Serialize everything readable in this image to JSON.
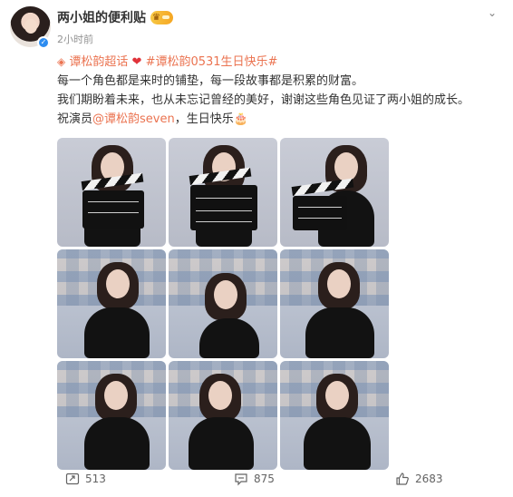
{
  "post": {
    "author": "两小姐的便利贴",
    "time": "2小时前",
    "topics": "谭松韵超话",
    "hashtag": "#谭松韵0531生日快乐#",
    "line1": "每一个角色都是来时的铺垫，每一段故事都是积累的财富。",
    "line2": "我们期盼着未来，也从未忘记曾经的美好，谢谢这些角色见证了两小姐的成长。",
    "line3_prefix": "祝演员",
    "mention": "@谭松韵seven",
    "line3_suffix": "，生日快乐",
    "cake_emoji": "🎂"
  },
  "icons": {
    "verified": "verified-badge-icon",
    "vip": "crown-badge-icon",
    "more": "chevron-down-icon",
    "topic": "location-icon",
    "heart": "heart-icon",
    "repost": "repost-icon",
    "comment": "comment-icon",
    "like": "like-icon"
  },
  "images": [
    {
      "scene": "clapperboard-studio"
    },
    {
      "scene": "clapperboard-studio"
    },
    {
      "scene": "clapperboard-studio"
    },
    {
      "scene": "photo-collage-wall"
    },
    {
      "scene": "photo-collage-wall"
    },
    {
      "scene": "photo-collage-wall"
    },
    {
      "scene": "photo-collage-wall"
    },
    {
      "scene": "photo-collage-wall"
    },
    {
      "scene": "photo-collage-wall"
    }
  ],
  "actions": {
    "repost_count": "513",
    "comment_count": "875",
    "like_count": "2683"
  },
  "colors": {
    "link": "#eb7350",
    "verified": "#2d8cf0",
    "heart": "#e0333a"
  }
}
